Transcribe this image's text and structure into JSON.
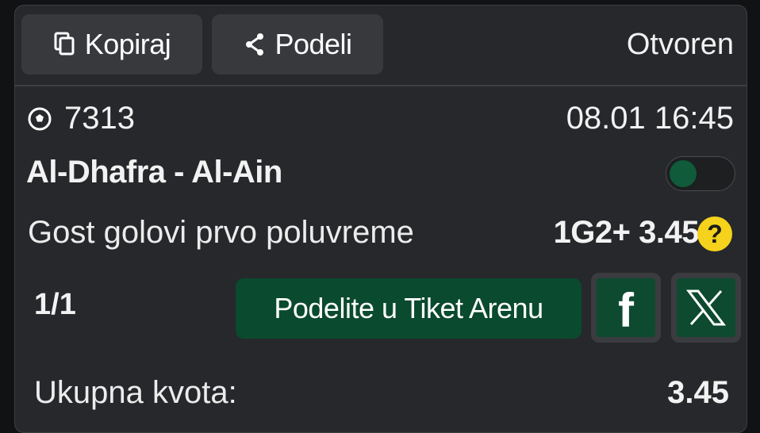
{
  "header": {
    "copy_label": "Kopiraj",
    "share_label": "Podeli",
    "status": "Otvoren"
  },
  "event": {
    "code": "7313",
    "datetime": "08.01 16:45",
    "match": "Al-Dhafra - Al-Ain",
    "market": "Gost golovi prvo poluvreme",
    "pick": "1G2+ 3.45",
    "sport_icon": "soccer-ball-icon",
    "help_icon": "question-icon"
  },
  "footer": {
    "count": "1/1",
    "arena_label": "Podelite u Tiket Arenu",
    "facebook_letter": "f",
    "total_label": "Ukupna kvota:",
    "total_value": "3.45"
  },
  "colors": {
    "background": "#26282b",
    "accent_green": "#0a4a2f",
    "help_yellow": "#f5d21c"
  }
}
